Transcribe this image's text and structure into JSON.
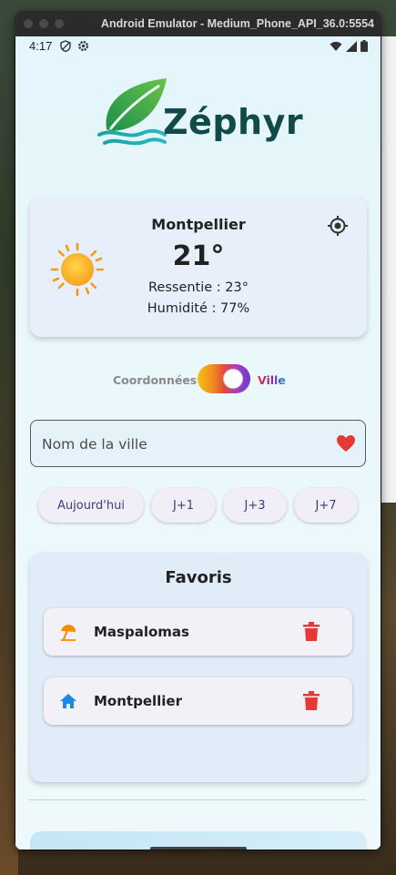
{
  "window": {
    "title": "Android Emulator - Medium_Phone_API_36.0:5554"
  },
  "status_bar": {
    "time": "4:17"
  },
  "app": {
    "name": "Zéphyr"
  },
  "weather": {
    "city": "Montpellier",
    "temperature": "21°",
    "feels_like": "Ressentie : 23°",
    "humidity": "Humidité : 77%",
    "condition_icon": "sun-icon"
  },
  "mode_toggle": {
    "left_label": "Coordonnées",
    "right_label": "Ville",
    "selected": "Ville"
  },
  "search": {
    "placeholder": "Nom de la ville",
    "value": ""
  },
  "forecast_chips": [
    {
      "label": "Aujourd'hui"
    },
    {
      "label": "J+1"
    },
    {
      "label": "J+3"
    },
    {
      "label": "J+7"
    }
  ],
  "favorites": {
    "title": "Favoris",
    "items": [
      {
        "name": "Maspalomas",
        "icon": "beach-umbrella-icon"
      },
      {
        "name": "Montpellier",
        "icon": "home-icon"
      }
    ]
  },
  "colors": {
    "accent_purple": "#3b3f7a",
    "delete_red": "#e53935",
    "heart_red": "#e53935",
    "home_blue": "#1e88e5",
    "umbrella_orange": "#fb8c00",
    "logo_green": "#114a48"
  }
}
